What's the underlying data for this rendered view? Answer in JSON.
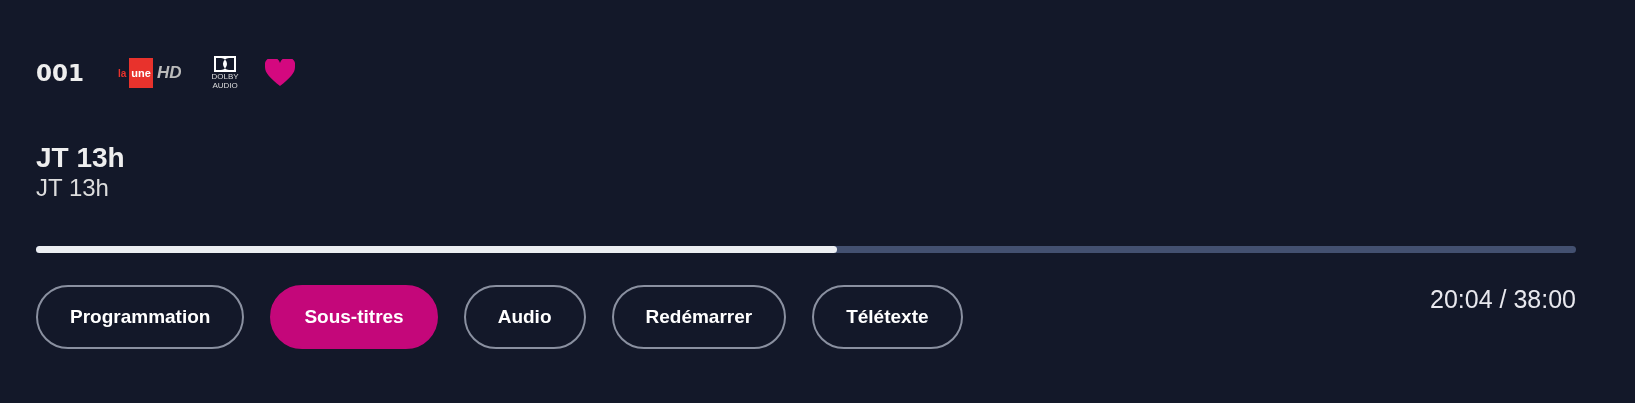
{
  "channel": {
    "number": "001",
    "logo": {
      "prefix": "la",
      "name": "une",
      "suffix": "HD"
    },
    "audio_badge": {
      "line1": "DOLBY",
      "line2": "AUDIO"
    },
    "favorite": true
  },
  "programme": {
    "title": "JT 13h",
    "subtitle": "JT 13h"
  },
  "progress": {
    "level": 0.52
  },
  "buttons": [
    {
      "label": "Programmation",
      "selected": false
    },
    {
      "label": "Sous-titres",
      "selected": true
    },
    {
      "label": "Audio",
      "selected": false
    },
    {
      "label": "Redémarrer",
      "selected": false
    },
    {
      "label": "Télétexte",
      "selected": false
    }
  ],
  "time": "20:04 / 38:00"
}
